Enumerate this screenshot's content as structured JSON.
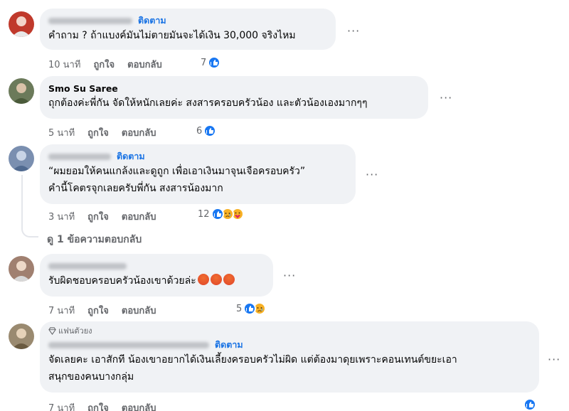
{
  "comments": [
    {
      "follow": "ติดตาม",
      "text": "คำถาม ? ถ้าแบงค์มันไม่ตายมันจะได้เงิน 30,000 จริงไหม",
      "time": "10 นาที",
      "like": "ถูกใจ",
      "reply": "ตอบกลับ",
      "reaction_count": "7",
      "avatar_color": "#c0392b"
    },
    {
      "name": "Smo Su Saree",
      "text": "ถุกต้องค่ะพี่กัน จัดให้หนักเลยค่ะ สงสารครอบครัวน้อง และตัวน้องเองมากๆๆ",
      "time": "5 นาที",
      "like": "ถูกใจ",
      "reply": "ตอบกลับ",
      "reaction_count": "6",
      "avatar_color": "#6b7a5a"
    },
    {
      "follow": "ติดตาม",
      "text_line1": "“ผมยอมให้คนแกล้งและดูถูก เพื่อเอาเงินมาจุนเจือครอบครัว”",
      "text_line2": "คำนี้โคตรจุกเลยครับพี่กัน สงสารน้องมาก",
      "time": "3 นาที",
      "like": "ถูกใจ",
      "reply": "ตอบกลับ",
      "reaction_count": "12",
      "view_replies": "ดู 1 ข้อความตอบกลับ",
      "avatar_color": "#7a8fb0"
    },
    {
      "text": "รับผิดชอบครอบครัวน้องเขาด้วยล่ะ",
      "time": "7 นาที",
      "like": "ถูกใจ",
      "reply": "ตอบกลับ",
      "reaction_count": "5",
      "avatar_color": "#a08070"
    },
    {
      "badge": "แฟนตัวยง",
      "follow": "ติดตาม",
      "text_line1": "จัดเลยคะ เอาสักที น้องเขาอยากได้เงินเลี้ยงครอบครัวไม่ผิด แต่ต้องมาดุยเพราะคอนเทนต์ขยะเอา",
      "text_line2": "สนุกของคนบางกลุ่ม",
      "time": "7 นาที",
      "like": "ถูกใจ",
      "reply": "ตอบกลับ",
      "avatar_color": "#9a8a70"
    }
  ],
  "more_glyph": "···",
  "colors": {
    "link": "#1b74e4",
    "bubble": "#f0f2f5",
    "meta": "#65676b",
    "like": "#1877f2"
  }
}
